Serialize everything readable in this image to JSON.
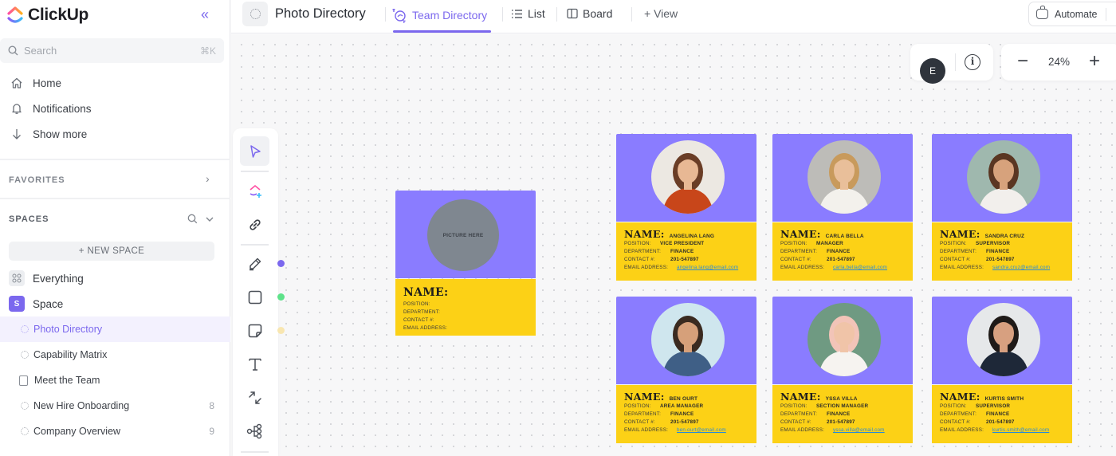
{
  "app": {
    "name": "ClickUp",
    "accent_color": "#7b68ee"
  },
  "sidebar": {
    "collapse_icon": "double-chevron-left-icon",
    "search": {
      "placeholder": "Search",
      "shortcut": "⌘K"
    },
    "nav": [
      {
        "label": "Home",
        "icon": "home-icon"
      },
      {
        "label": "Notifications",
        "icon": "bell-icon"
      },
      {
        "label": "Show more",
        "icon": "arrow-down-icon"
      }
    ],
    "favorites_label": "FAVORITES",
    "spaces_label": "SPACES",
    "new_space_label": "+ NEW SPACE",
    "everything_label": "Everything",
    "space": {
      "label": "Space",
      "badge": "S"
    },
    "lists": [
      {
        "label": "Photo Directory",
        "icon": "whiteboard-icon",
        "active": true,
        "count": ""
      },
      {
        "label": "Capability Matrix",
        "icon": "whiteboard-icon",
        "active": false,
        "count": ""
      },
      {
        "label": "Meet the Team",
        "icon": "doc-icon",
        "active": false,
        "count": ""
      },
      {
        "label": "New Hire Onboarding",
        "icon": "whiteboard-icon",
        "active": false,
        "count": "8"
      },
      {
        "label": "Company Overview",
        "icon": "whiteboard-icon",
        "active": false,
        "count": "9"
      }
    ]
  },
  "topbar": {
    "title": "Photo Directory",
    "tabs": [
      {
        "label": "Team Directory",
        "icon": "whiteboard-icon",
        "active": true
      },
      {
        "label": "List",
        "icon": "list-icon",
        "active": false
      },
      {
        "label": "Board",
        "icon": "board-icon",
        "active": false
      },
      {
        "label": "+ View",
        "icon": "",
        "active": false
      }
    ],
    "automate_label": "Automate"
  },
  "canvas_controls": {
    "avatar_initial": "E",
    "zoom_level": "24%",
    "zoom_out": "−",
    "zoom_in": "+"
  },
  "toolbar": {
    "tools": [
      "select-pointer",
      "clickup-ai-create",
      "link",
      "pen",
      "rectangle",
      "sticky-note",
      "text",
      "connector",
      "mind-map"
    ],
    "pen_color": "#7b68ee",
    "shape_color": "#5ee28a",
    "sticky_color": "#f8e6b0"
  },
  "template_card": {
    "picture_text": "PICTURE HERE",
    "name_label": "NAME:",
    "fields": [
      "POSITION:",
      "DEPARTMENT:",
      "CONTACT #:",
      "EMAIL ADDRESS:"
    ]
  },
  "card_labels": {
    "name": "NAME:",
    "position": "POSITION:",
    "department": "DEPARTMENT:",
    "contact": "CONTACT #:",
    "email": "EMAIL ADDRESS:"
  },
  "employees": [
    {
      "name": "ANGELINA LANG",
      "position": "VICE PRESIDENT",
      "department": "FINANCE",
      "contact": "201-547897",
      "email": "angelina.lang@email.com"
    },
    {
      "name": "CARLA BELLA",
      "position": "MANAGER",
      "department": "FINANCE",
      "contact": "201-547897",
      "email": "carla.bella@email.com"
    },
    {
      "name": "SANDRA CRUZ",
      "position": "SUPERVISOR",
      "department": "FINANCE",
      "contact": "201-547897",
      "email": "sandra.cruz@email.com"
    },
    {
      "name": "BEN OURT",
      "position": "AREA MANAGER",
      "department": "FINANCE",
      "contact": "201-547897",
      "email": "ben.ourt@email.com"
    },
    {
      "name": "YSSA VILLA",
      "position": "SECTION MANAGER",
      "department": "FINANCE",
      "contact": "201-547897",
      "email": "yssa.villa@email.com"
    },
    {
      "name": "KURTIS SMITH",
      "position": "SUPERVISOR",
      "department": "FINANCE",
      "contact": "201-547897",
      "email": "kurtis.smith@email.com"
    }
  ],
  "card_colors": {
    "header": "#8a7cff",
    "body": "#fcd116"
  }
}
